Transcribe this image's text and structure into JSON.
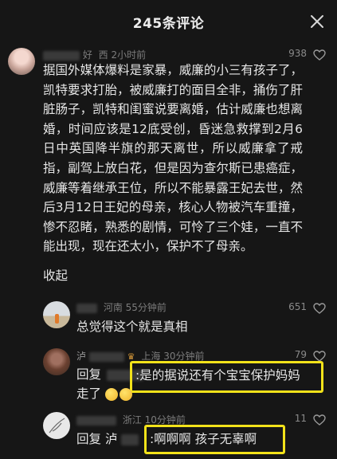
{
  "header": {
    "title": "245条评论",
    "close_icon": "close-icon"
  },
  "main_comment": {
    "user_suffix": "好",
    "time_location": "西 2小时前",
    "likes": "938",
    "body": "据国外媒体爆料是家暴，威廉的小三有孩子了，凯特要求打胎，被威廉打的面目全非，捅伤了肝脏肠子，凯特和闺蜜说要离婚，估计威廉也想离婚，时间应该是12底受创，昏迷急救撑到2月6日中英国降半旗的那天离世，所以威廉拿了戒指，副驾上放白花，但是因为查尔斯已患癌症，威廉等着继承王位，所以不能暴露王妃去世，然后3月12日王妃的母亲，核心人物被汽车重撞，惨不忍睹，熟悉的剧情，可怜了三个娃，一直不能出现，现在还太小，保护不了母亲。",
    "collapse": "收起"
  },
  "reply1": {
    "location_time": "河南 55分钟前",
    "likes": "651",
    "text": "总觉得这个就是真相"
  },
  "reply2": {
    "name_initial": "泸",
    "location_time": "上海 30分钟前",
    "likes": "79",
    "reply_prefix": "回复",
    "highlight_text": ":是的据说还有个宝宝保护妈妈",
    "line2": "走了"
  },
  "reply3": {
    "location_time": "浙江 10分钟前",
    "likes": "11",
    "reply_prefix": "回复",
    "name_initial": "泸",
    "highlight_text": ":啊啊啊 孩子无辜啊"
  },
  "colors": {
    "background": "#161616",
    "highlight": "#f2e21a"
  }
}
